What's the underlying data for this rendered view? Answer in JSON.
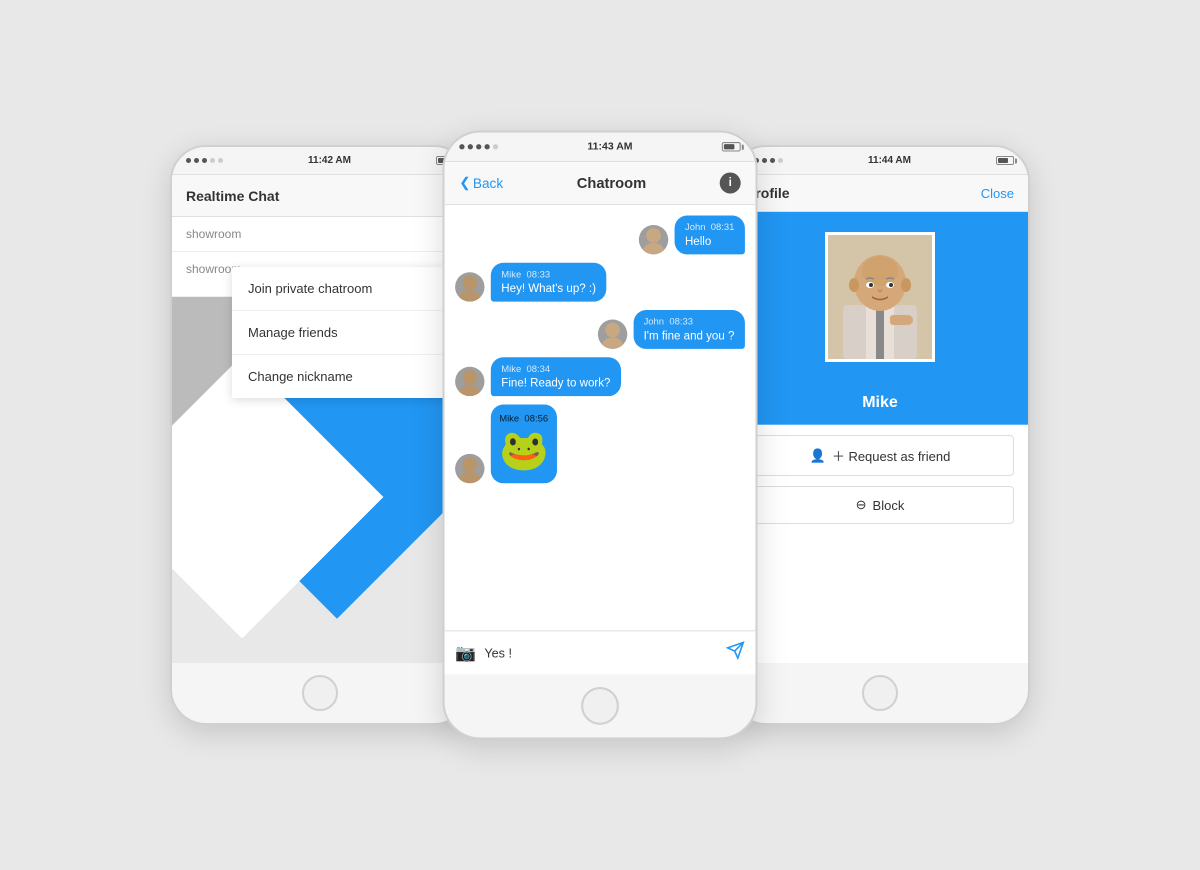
{
  "phone1": {
    "status_bar": {
      "dots": 5,
      "time": "11:42 AM",
      "battery": "70"
    },
    "header": {
      "title": "Realtime Chat",
      "menu_icon": "⋮"
    },
    "list_items": [
      {
        "label": "showroom"
      },
      {
        "label": "showroom"
      }
    ],
    "dropdown": {
      "items": [
        "Join private chatroom",
        "Manage friends",
        "Change nickname"
      ]
    }
  },
  "phone2": {
    "status_bar": {
      "time": "11:43 AM"
    },
    "header": {
      "back_label": "Back",
      "title": "Chatroom",
      "info_icon": "i"
    },
    "messages": [
      {
        "sender": "John",
        "time": "08:31",
        "text": "Hello",
        "side": "right",
        "avatar": "J"
      },
      {
        "sender": "Mike",
        "time": "08:33",
        "text": "Hey! What's up? :)",
        "side": "left",
        "avatar": "M"
      },
      {
        "sender": "John",
        "time": "08:33",
        "text": "I'm fine and you ?",
        "side": "right",
        "avatar": "J"
      },
      {
        "sender": "Mike",
        "time": "08:34",
        "text": "Fine! Ready to work?",
        "side": "left",
        "avatar": "M"
      },
      {
        "sender": "Mike",
        "time": "08:56",
        "text": "",
        "side": "left",
        "avatar": "M",
        "is_emoji": true
      }
    ],
    "input": {
      "placeholder": "Yes !",
      "camera_icon": "📷",
      "send_icon": "➤"
    }
  },
  "phone3": {
    "status_bar": {
      "time": "11:44 AM"
    },
    "header": {
      "title": "Profile",
      "close_label": "Close"
    },
    "profile": {
      "name": "Mike",
      "request_friend_label": "＋ Request as friend",
      "block_label": "⊖ Block"
    }
  }
}
